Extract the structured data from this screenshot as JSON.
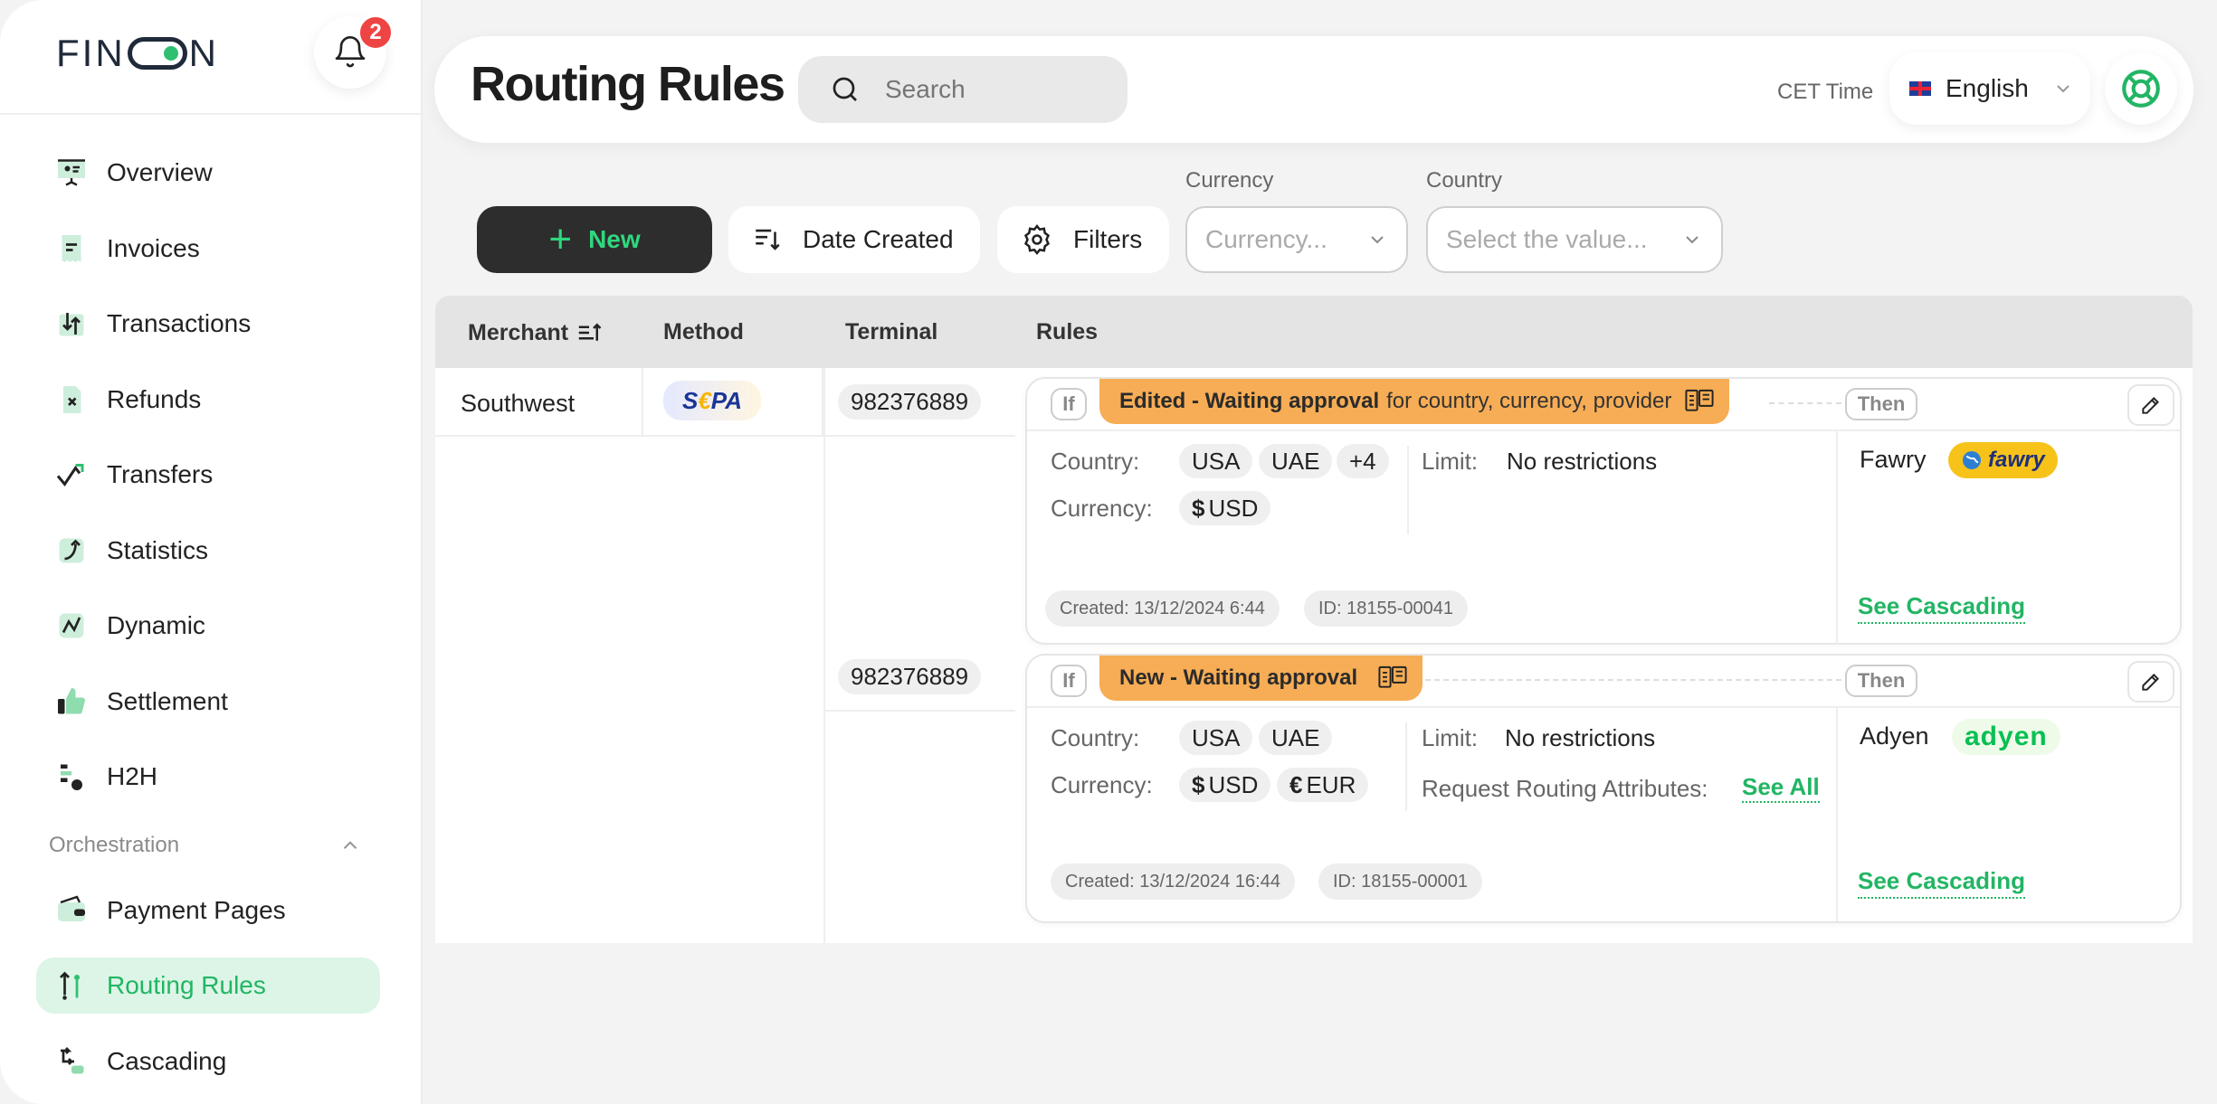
{
  "sidebar": {
    "logo_text_left": "FIN",
    "logo_text_right": "N",
    "notifications_count": "2",
    "items": [
      {
        "label": "Overview",
        "icon": "presentation-icon"
      },
      {
        "label": "Invoices",
        "icon": "invoice-icon"
      },
      {
        "label": "Transactions",
        "icon": "transactions-icon"
      },
      {
        "label": "Refunds",
        "icon": "refund-icon"
      },
      {
        "label": "Transfers",
        "icon": "transfer-icon"
      },
      {
        "label": "Statistics",
        "icon": "statistics-icon"
      },
      {
        "label": "Dynamic",
        "icon": "dynamic-icon"
      },
      {
        "label": "Settlement",
        "icon": "thumb-up-icon"
      },
      {
        "label": "H2H",
        "icon": "h2h-icon"
      }
    ],
    "section_label": "Orchestration",
    "section_items": [
      {
        "label": "Payment Pages",
        "icon": "wallet-icon"
      },
      {
        "label": "Routing Rules",
        "icon": "routing-icon",
        "active": true
      },
      {
        "label": "Cascading",
        "icon": "cascade-icon"
      }
    ]
  },
  "header": {
    "title": "Routing Rules",
    "search_placeholder": "Search",
    "time_label": "CET Time",
    "language": "English"
  },
  "toolbar": {
    "new_label": "New",
    "sort_label": "Date Created",
    "filters_label": "Filters",
    "currency_label": "Currency",
    "currency_placeholder": "Currency...",
    "country_label": "Country",
    "country_placeholder": "Select the value..."
  },
  "table": {
    "headers": [
      "Merchant",
      "Method",
      "Terminal",
      "Rules"
    ],
    "merchant": "Southwest",
    "method_logo": {
      "left": "S",
      "mid": "€",
      "right": "PA"
    },
    "rows": [
      {
        "terminal": "982376889",
        "if_label": "If",
        "status_bold": "Edited - Waiting approval",
        "status_rest": "for country, currency, provider",
        "then_label": "Then",
        "country_label": "Country:",
        "countries": [
          "USA",
          "UAE",
          "+4"
        ],
        "currency_label": "Currency:",
        "currencies": [
          {
            "sym": "$",
            "code": "USD"
          }
        ],
        "limit_label": "Limit:",
        "limit_value": "No restrictions",
        "created": "Created: 13/12/2024 6:44",
        "id": "ID: 18155-00041",
        "provider": "Fawry",
        "provider_logo": "fawry",
        "cascade_label": "See Cascading"
      },
      {
        "terminal": "982376889",
        "if_label": "If",
        "status_bold": "New - Waiting approval",
        "status_rest": "",
        "then_label": "Then",
        "country_label": "Country:",
        "countries": [
          "USA",
          "UAE"
        ],
        "currency_label": "Currency:",
        "currencies": [
          {
            "sym": "$",
            "code": "USD"
          },
          {
            "sym": "€",
            "code": "EUR"
          }
        ],
        "limit_label": "Limit:",
        "limit_value": "No restrictions",
        "attributes_label": "Request Routing Attributes:",
        "see_all_label": "See All",
        "created": "Created: 13/12/2024 16:44",
        "id": "ID: 18155-00001",
        "provider": "Adyen",
        "provider_logo": "adyen",
        "cascade_label": "See Cascading"
      }
    ]
  },
  "colors": {
    "accent": "#22b564",
    "status_orange": "#f7ad55",
    "dark_button": "#2d2d2d",
    "badge_red": "#ef4444"
  }
}
